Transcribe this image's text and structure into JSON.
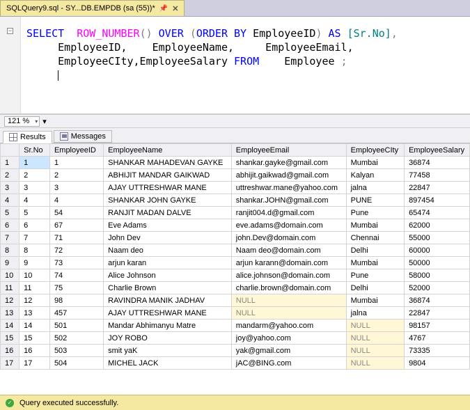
{
  "tab": {
    "title": "SQLQuery9.sql - SY...DB.EMPDB (sa (55))*",
    "close": "✕",
    "pin": "📌"
  },
  "sql": {
    "line1a": "SELECT",
    "line1b": "ROW_NUMBER",
    "line1c": "()",
    "line1d": "OVER",
    "line1e": "(",
    "line1f": "ORDER",
    "line1g": "BY",
    "line1h": "EmployeeID",
    "line1i": ")",
    "line1j": "AS",
    "line1k": "[Sr.No]",
    "line1l": ",",
    "line2": "EmployeeID,    EmployeeName,     EmployeeEmail,",
    "line3a": "EmployeeCIty,EmployeeSalary",
    "line3b": "FROM",
    "line3c": "Employee",
    "line3d": ";"
  },
  "zoom": "121 %",
  "rtabs": {
    "results": "Results",
    "messages": "Messages"
  },
  "cols": [
    "",
    "Sr.No",
    "EmployeeID",
    "EmployeeName",
    "EmployeeEmail",
    "EmployeeCIty",
    "EmployeeSalary"
  ],
  "rows": [
    {
      "n": "1",
      "sr": "1",
      "id": "1",
      "name": "SHANKAR MAHADEVAN GAYKE",
      "email": "shankar.gayke@gmail.com",
      "city": "Mumbai",
      "sal": "36874"
    },
    {
      "n": "2",
      "sr": "2",
      "id": "2",
      "name": "ABHIJIT MANDAR GAIKWAD",
      "email": "abhijit.gaikwad@gmail.com",
      "city": "Kalyan",
      "sal": "77458"
    },
    {
      "n": "3",
      "sr": "3",
      "id": "3",
      "name": "AJAY UTTRESHWAR MANE",
      "email": "uttreshwar.mane@yahoo.com",
      "city": "jalna",
      "sal": "22847"
    },
    {
      "n": "4",
      "sr": "4",
      "id": "4",
      "name": "SHANKAR JOHN GAYKE",
      "email": "shankar.JOHN@gmail.com",
      "city": "PUNE",
      "sal": "897454"
    },
    {
      "n": "5",
      "sr": "5",
      "id": "54",
      "name": "RANJIT MADAN DALVE",
      "email": "ranjit004.d@gmail.com",
      "city": "Pune",
      "sal": "65474"
    },
    {
      "n": "6",
      "sr": "6",
      "id": "67",
      "name": "Eve Adams",
      "email": "eve.adams@domain.com",
      "city": "Mumbai",
      "sal": "62000"
    },
    {
      "n": "7",
      "sr": "7",
      "id": "71",
      "name": "John Dev",
      "email": "john.Dev@domain.com",
      "city": "Chennai",
      "sal": "55000"
    },
    {
      "n": "8",
      "sr": "8",
      "id": "72",
      "name": "Naam deo",
      "email": "Naam deo@domain.com",
      "city": "Delhi",
      "sal": "60000"
    },
    {
      "n": "9",
      "sr": "9",
      "id": "73",
      "name": "arjun karan",
      "email": "arjun karann@domain.com",
      "city": "Mumbai",
      "sal": "50000"
    },
    {
      "n": "10",
      "sr": "10",
      "id": "74",
      "name": "Alice Johnson",
      "email": "alice.johnson@domain.com",
      "city": "Pune",
      "sal": "58000"
    },
    {
      "n": "11",
      "sr": "11",
      "id": "75",
      "name": "Charlie Brown",
      "email": "charlie.brown@domain.com",
      "city": "Delhi",
      "sal": "52000"
    },
    {
      "n": "12",
      "sr": "12",
      "id": "98",
      "name": "RAVINDRA MANIK JADHAV",
      "email": "NULL",
      "emailNull": true,
      "city": "Mumbai",
      "sal": "36874"
    },
    {
      "n": "13",
      "sr": "13",
      "id": "457",
      "name": "AJAY UTTRESHWAR MANE",
      "email": "NULL",
      "emailNull": true,
      "city": "jalna",
      "sal": "22847"
    },
    {
      "n": "14",
      "sr": "14",
      "id": "501",
      "name": "Mandar Abhimanyu Matre",
      "email": "mandarm@yahoo.com",
      "city": "NULL",
      "cityNull": true,
      "sal": "98157"
    },
    {
      "n": "15",
      "sr": "15",
      "id": "502",
      "name": "JOY ROBO",
      "email": "joy@yahoo.com",
      "city": "NULL",
      "cityNull": true,
      "sal": "4767"
    },
    {
      "n": "16",
      "sr": "16",
      "id": "503",
      "name": "smit yaK",
      "email": "yak@gmail.com",
      "city": "NULL",
      "cityNull": true,
      "sal": "73335"
    },
    {
      "n": "17",
      "sr": "17",
      "id": "504",
      "name": "MICHEL JACK",
      "email": "jAC@BING.com",
      "city": "NULL",
      "cityNull": true,
      "sal": "9804"
    }
  ],
  "status": "Query executed successfully."
}
